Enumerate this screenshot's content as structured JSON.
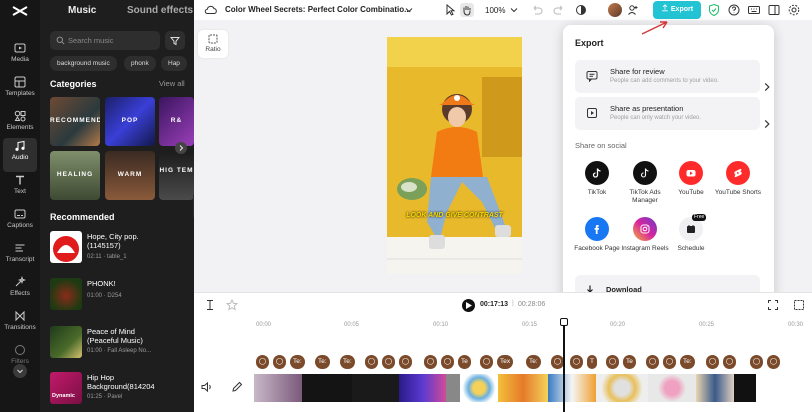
{
  "panel": {
    "tabs": [
      "Music",
      "Sound effects"
    ],
    "search_placeholder": "Search music",
    "chips": [
      "background music",
      "phonk",
      "Hap"
    ],
    "categories_title": "Categories",
    "view_all": "View all",
    "categories": [
      "RECOMMEND",
      "POP",
      "R&",
      "HEALING",
      "WARM",
      "HIG TEM"
    ],
    "recommended_title": "Recommended",
    "tracks": [
      {
        "title": "Hope, City pop.",
        "title2": "(1145157)",
        "meta": "02:11 · table_1"
      },
      {
        "title": "PHONK!",
        "title2": "",
        "meta": "01:00 · D254"
      },
      {
        "title": "Peace of Mind",
        "title2": "(Peaceful Music)",
        "meta": "01:00 · Fall Asleep No..."
      },
      {
        "title": "Hip Hop",
        "title2": "Background(814204",
        "meta": "01:25 · Pavel"
      }
    ],
    "track4_badge": "Dynamic"
  },
  "rail": [
    {
      "label": "Media",
      "icon": "media-icon"
    },
    {
      "label": "Templates",
      "icon": "templates-icon"
    },
    {
      "label": "Elements",
      "icon": "elements-icon"
    },
    {
      "label": "Audio",
      "icon": "audio-icon"
    },
    {
      "label": "Text",
      "icon": "text-icon"
    },
    {
      "label": "Captions",
      "icon": "captions-icon"
    },
    {
      "label": "Transcript",
      "icon": "transcript-icon"
    },
    {
      "label": "Effects",
      "icon": "effects-icon"
    },
    {
      "label": "Transitions",
      "icon": "transitions-icon"
    },
    {
      "label": "Filters",
      "icon": "filters-icon"
    }
  ],
  "top": {
    "title": "Color Wheel Secrets: Perfect Color Combinatio...",
    "zoom": "100%",
    "export": "Export"
  },
  "canvas": {
    "ratio": "Ratio",
    "caption": "LOOK AND GIVE CONTRAST"
  },
  "export_popup": {
    "title": "Export",
    "review_title": "Share for review",
    "review_sub": "People can add comments to your video.",
    "present_title": "Share as presentation",
    "present_sub": "People can only watch your video.",
    "social_title": "Share on social",
    "social": [
      {
        "label": "TikTok",
        "icon": "tiktok-icon",
        "color": "#111111"
      },
      {
        "label": "TikTok Ads Manager",
        "icon": "tiktok-ads-icon",
        "color": "#111111"
      },
      {
        "label": "YouTube",
        "icon": "youtube-icon",
        "color": "#ff2b2b"
      },
      {
        "label": "YouTube Shorts",
        "icon": "youtube-shorts-icon",
        "color": "#ff2b2b"
      },
      {
        "label": "Facebook Page",
        "icon": "facebook-icon",
        "color": "#1877f2"
      },
      {
        "label": "Instagram Reels",
        "icon": "instagram-icon",
        "color": "#d6249f"
      },
      {
        "label": "Schedule",
        "icon": "schedule-icon",
        "color": "#f0f0f2"
      }
    ],
    "free_badge": "Free",
    "download": "Download"
  },
  "player": {
    "current": "00:17:13",
    "separator": "|",
    "duration": "00:28:06"
  },
  "ruler": [
    "00:00",
    "00:05",
    "00:10",
    "00:15",
    "00:20",
    "00:25",
    "00:30"
  ],
  "text_pills": [
    "Te:",
    "Te:",
    "Te:",
    "Te",
    "Tex",
    "Te:",
    "T",
    "Te",
    "Te:"
  ],
  "accent": "#22c4d4",
  "pill_color": "#7a4a2b"
}
